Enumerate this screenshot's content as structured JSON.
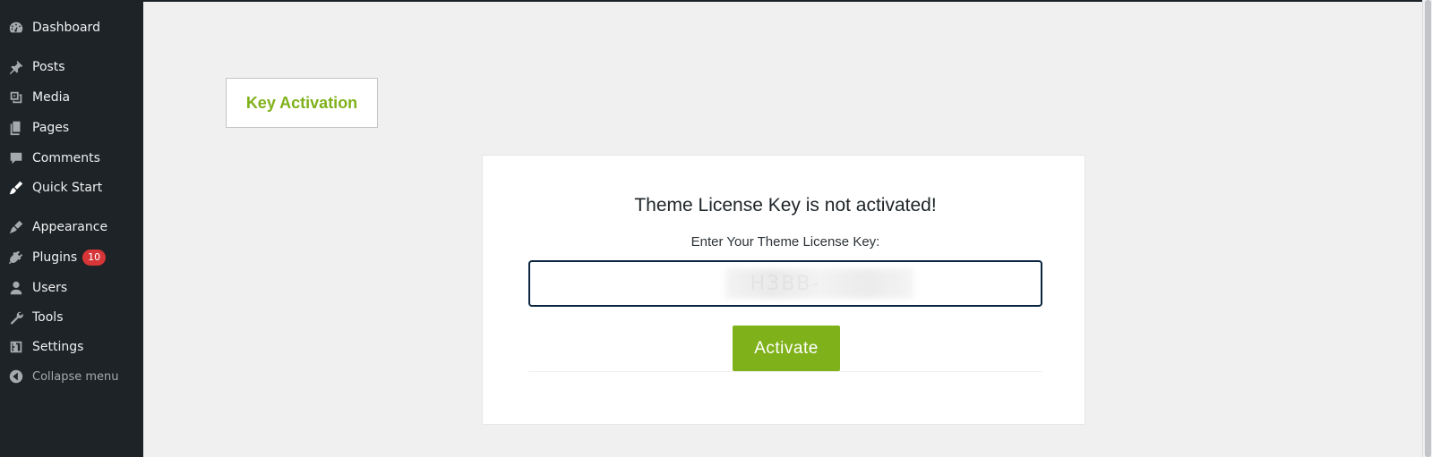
{
  "sidebar": {
    "items": [
      {
        "label": "Dashboard",
        "icon": "dashboard-icon"
      },
      {
        "label": "Posts",
        "icon": "pin-icon"
      },
      {
        "label": "Media",
        "icon": "media-icon"
      },
      {
        "label": "Pages",
        "icon": "pages-icon"
      },
      {
        "label": "Comments",
        "icon": "comment-icon"
      },
      {
        "label": "Quick Start",
        "icon": "brush-icon"
      },
      {
        "label": "Appearance",
        "icon": "appearance-icon"
      },
      {
        "label": "Plugins",
        "icon": "plugin-icon",
        "badge": "10"
      },
      {
        "label": "Users",
        "icon": "user-icon"
      },
      {
        "label": "Tools",
        "icon": "wrench-icon"
      },
      {
        "label": "Settings",
        "icon": "settings-icon"
      },
      {
        "label": "Collapse menu",
        "icon": "collapse-icon"
      }
    ]
  },
  "tab": {
    "label": "Key Activation"
  },
  "card": {
    "title": "Theme License Key is not activated!",
    "field_label": "Enter Your Theme License Key:",
    "key_value": "H3BB-",
    "button_label": "Activate"
  },
  "colors": {
    "sidebar_bg": "#1d2327",
    "accent_green": "#7fb11a",
    "badge_red": "#d63638",
    "page_bg": "#f0f0f1"
  }
}
